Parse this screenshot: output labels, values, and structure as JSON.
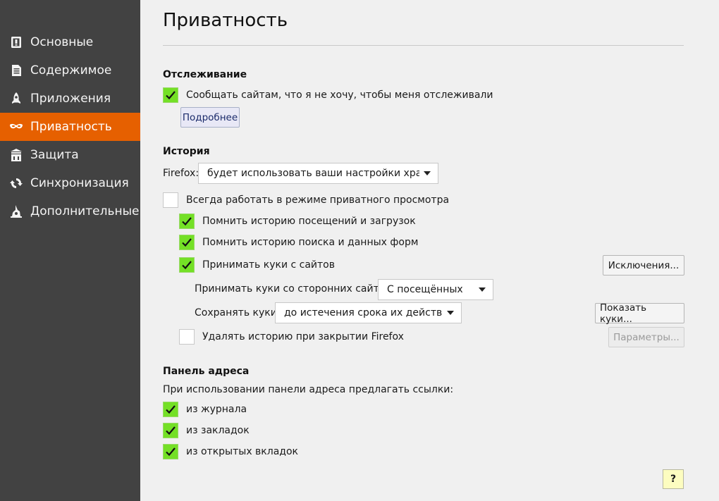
{
  "sidebar": {
    "items": [
      {
        "label": "Основные",
        "icon": "general-icon"
      },
      {
        "label": "Содержимое",
        "icon": "content-icon"
      },
      {
        "label": "Приложения",
        "icon": "applications-icon"
      },
      {
        "label": "Приватность",
        "icon": "privacy-mask-icon",
        "active": true
      },
      {
        "label": "Защита",
        "icon": "security-icon"
      },
      {
        "label": "Синхронизация",
        "icon": "sync-icon"
      },
      {
        "label": "Дополнительные",
        "icon": "advanced-icon"
      }
    ]
  },
  "page": {
    "title": "Приватность"
  },
  "tracking": {
    "title": "Отслеживание",
    "dnt_label": "Сообщать сайтам, что я не хочу, чтобы меня отслеживали",
    "dnt_checked": true,
    "learn_more": "Подробнее"
  },
  "history": {
    "title": "История",
    "firefox_label": "Firefox:",
    "mode_value": "будет использовать ваши настройки хран...",
    "private_label": "Всегда работать в режиме приватного просмотра",
    "private_checked": false,
    "remember_history_label": "Помнить историю посещений и загрузок",
    "remember_history_checked": true,
    "remember_search_label": "Помнить историю поиска и данных форм",
    "remember_search_checked": true,
    "accept_cookies_label": "Принимать куки с сайтов",
    "accept_cookies_checked": true,
    "exceptions_button": "Исключения...",
    "third_party_label": "Принимать куки со сторонних сайтов:",
    "third_party_value": "С посещённых",
    "keep_until_label": "Сохранять куки:",
    "keep_until_value": "до истечения срока их действия",
    "show_cookies_button": "Показать куки...",
    "clear_on_close_label": "Удалять историю при закрытии Firefox",
    "clear_on_close_checked": false,
    "settings_button": "Параметры..."
  },
  "location_bar": {
    "title": "Панель адреса",
    "suggest_label": "При использовании панели адреса предлагать ссылки:",
    "history_label": "из журнала",
    "history_checked": true,
    "bookmarks_label": "из закладок",
    "bookmarks_checked": true,
    "open_tabs_label": "из открытых вкладок",
    "open_tabs_checked": true
  },
  "help_button": "?",
  "colors": {
    "sidebar_bg": "#424242",
    "active_item": "#e66000",
    "checkbox_checked": "#74e026"
  }
}
